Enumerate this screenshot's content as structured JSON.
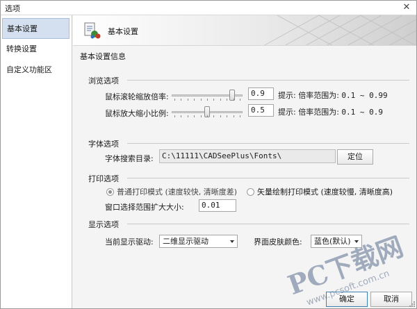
{
  "window": {
    "title": "选项",
    "close_glyph": "✕"
  },
  "sidebar": {
    "items": [
      {
        "label": "基本设置",
        "active": true
      },
      {
        "label": "转换设置",
        "active": false
      },
      {
        "label": "自定义功能区",
        "active": false
      }
    ]
  },
  "banner": {
    "title": "基本设置",
    "icon": "settings-document-icon"
  },
  "info_title": "基本设置信息",
  "browse": {
    "label": "浏览选项",
    "scroll_zoom": {
      "label": "鼠标滚轮缩放倍率:",
      "value": "0.9",
      "hint_prefix": "提示: 倍率范围为:",
      "hint_range": "0.1 ~ 0.99",
      "slider_level": 0.88
    },
    "mag_ratio": {
      "label": "鼠标放大缩小比例:",
      "value": "0.5",
      "hint_prefix": "提示: 倍率范围为:",
      "hint_range": "0.1 ~ 0.9",
      "slider_level": 0.5
    }
  },
  "font": {
    "label": "字体选项",
    "search_dir_label": "字体搜索目录:",
    "search_dir_value": "C:\\11111\\CADSeePlus\\Fonts\\",
    "locate_button": "定位"
  },
  "print": {
    "label": "打印选项",
    "mode_normal": "普通打印模式 (速度较快, 清晰度差)",
    "mode_vector": "矢量绘制打印模式 (速度较慢, 清晰度高)",
    "selected": "normal",
    "expand_label": "窗口选择范围扩大大小:",
    "expand_value": "0.01"
  },
  "display": {
    "label": "显示选项",
    "driver_label": "当前显示驱动:",
    "driver_value": "二维显示驱动",
    "skin_label": "界面皮肤颜色:",
    "skin_value": "蓝色(默认)"
  },
  "footer": {
    "ok": "确定",
    "cancel": "取消"
  },
  "watermark": {
    "text": "PC下载网",
    "url": "www.pcsoft.com.cn",
    "color": "#5b6f8f"
  },
  "colors": {
    "active_item": "#d4e0f0",
    "primary_border": "#3c7fb1"
  }
}
